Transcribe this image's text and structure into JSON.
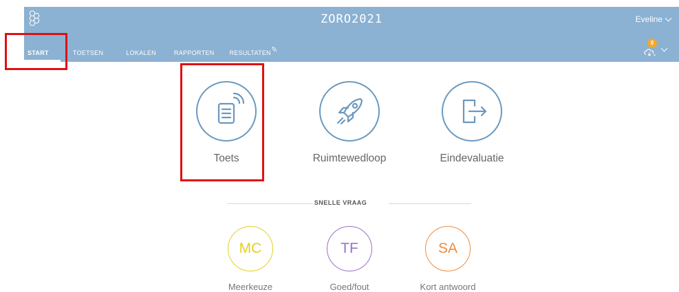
{
  "header": {
    "app_title": "ZORO2021",
    "user_name": "Eveline",
    "notification_count": "0",
    "colors": {
      "bar": "#8bb1d3",
      "badge": "#f0a830"
    }
  },
  "nav": {
    "items": [
      {
        "label": "START",
        "active": true
      },
      {
        "label": "TOETSEN"
      },
      {
        "label": "LOKALEN"
      },
      {
        "label": "RAPPORTEN"
      },
      {
        "label": "RESULTATEN"
      }
    ]
  },
  "main": {
    "tiles": [
      {
        "label": "Toets",
        "icon": "live-test-icon"
      },
      {
        "label": "Ruimtewedloop",
        "icon": "rocket-icon"
      },
      {
        "label": "Eindevaluatie",
        "icon": "exit-icon"
      }
    ],
    "quick_question": {
      "title": "SNELLE VRAAG",
      "items": [
        {
          "abbr": "MC",
          "label": "Meerkeuze",
          "color": "#e6cf1e"
        },
        {
          "abbr": "TF",
          "label": "Goed/fout",
          "color": "#9a6fcc"
        },
        {
          "abbr": "SA",
          "label": "Kort antwoord",
          "color": "#ef8c3c"
        }
      ]
    }
  }
}
